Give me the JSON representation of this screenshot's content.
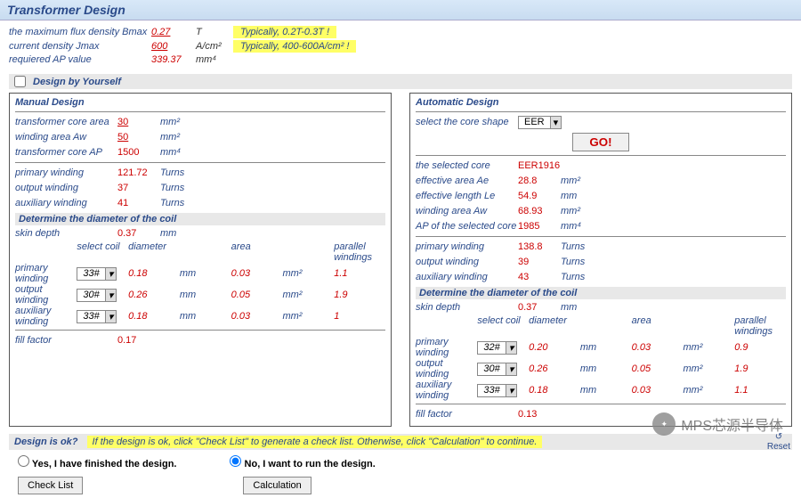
{
  "banner": "Transformer Design",
  "top": {
    "rows": [
      {
        "label": "the maximum flux density Bmax",
        "val": "0.27",
        "unit": "T",
        "hint": "Typically, 0.2T-0.3T !"
      },
      {
        "label": "current density Jmax",
        "val": "600",
        "unit": "A/cm²",
        "hint": "Typically, 400-600A/cm² !"
      },
      {
        "label": "requiered AP value",
        "val": "339.37",
        "unit": "mm⁴",
        "hint": ""
      }
    ]
  },
  "section_label": "Design by Yourself",
  "manual": {
    "title": "Manual Design",
    "rows1": [
      {
        "label": "transformer core area",
        "val": "30",
        "unit": "mm²",
        "u": true
      },
      {
        "label": "winding area Aw",
        "val": "50",
        "unit": "mm²",
        "u": true
      },
      {
        "label": "transformer core AP",
        "val": "1500",
        "unit": "mm⁴",
        "u": false
      }
    ],
    "rows2": [
      {
        "label": "primary winding",
        "val": "121.72",
        "unit": "Turns"
      },
      {
        "label": "output winding",
        "val": "37",
        "unit": "Turns"
      },
      {
        "label": "auxiliary winding",
        "val": "41",
        "unit": "Turns"
      }
    ],
    "coil_title": "Determine the diameter of the coil",
    "skin": {
      "label": "skin depth",
      "val": "0.37",
      "unit": "mm"
    },
    "coil_hdr": [
      "",
      "select coil",
      "diameter",
      "",
      "area",
      "",
      "parallel windings"
    ],
    "coil_rows": [
      {
        "label": "primary winding",
        "coil": "33#",
        "dia": "0.18",
        "du": "mm",
        "area": "0.03",
        "au": "mm²",
        "pw": "1.1"
      },
      {
        "label": "output winding",
        "coil": "30#",
        "dia": "0.26",
        "du": "mm",
        "area": "0.05",
        "au": "mm²",
        "pw": "1.9"
      },
      {
        "label": "auxiliary winding",
        "coil": "33#",
        "dia": "0.18",
        "du": "mm",
        "area": "0.03",
        "au": "mm²",
        "pw": "1"
      }
    ],
    "fill": {
      "label": "fill factor",
      "val": "0.17"
    }
  },
  "auto": {
    "title": "Automatic Design",
    "shape_label": "select the core shape",
    "shape_val": "EER",
    "go": "GO!",
    "selected_label": "the selected core",
    "selected_val": "EER1916",
    "rows1": [
      {
        "label": "effective area Ae",
        "val": "28.8",
        "unit": "mm²"
      },
      {
        "label": "effective length Le",
        "val": "54.9",
        "unit": "mm"
      },
      {
        "label": "winding area Aw",
        "val": "68.93",
        "unit": "mm²"
      },
      {
        "label": "AP of the selected core",
        "val": "1985",
        "unit": "mm⁴"
      }
    ],
    "rows2": [
      {
        "label": "primary winding",
        "val": "138.8",
        "unit": "Turns"
      },
      {
        "label": "output winding",
        "val": "39",
        "unit": "Turns"
      },
      {
        "label": "auxiliary winding",
        "val": "43",
        "unit": "Turns"
      }
    ],
    "coil_title": "Determine the diameter of the coil",
    "skin": {
      "label": "skin depth",
      "val": "0.37",
      "unit": "mm"
    },
    "coil_hdr": [
      "",
      "select coil",
      "diameter",
      "",
      "area",
      "",
      "parallel windings"
    ],
    "coil_rows": [
      {
        "label": "primary winding",
        "coil": "32#",
        "dia": "0.20",
        "du": "mm",
        "area": "0.03",
        "au": "mm²",
        "pw": "0.9"
      },
      {
        "label": "output winding",
        "coil": "30#",
        "dia": "0.26",
        "du": "mm",
        "area": "0.05",
        "au": "mm²",
        "pw": "1.9"
      },
      {
        "label": "auxiliary winding",
        "coil": "33#",
        "dia": "0.18",
        "du": "mm",
        "area": "0.03",
        "au": "mm²",
        "pw": "1.1"
      }
    ],
    "fill": {
      "label": "fill factor",
      "val": "0.13"
    }
  },
  "footer": {
    "q": "Design is ok?",
    "hint": "If the design is ok, click \"Check List\" to generate a check list. Otherwise, click \"Calculation\" to continue.",
    "r1": "Yes, I have finished the design.",
    "r2": "No, I want to run the design.",
    "b1": "Check List",
    "b2": "Calculation"
  },
  "watermark": "MPS芯源半导体",
  "reset": "Reset"
}
